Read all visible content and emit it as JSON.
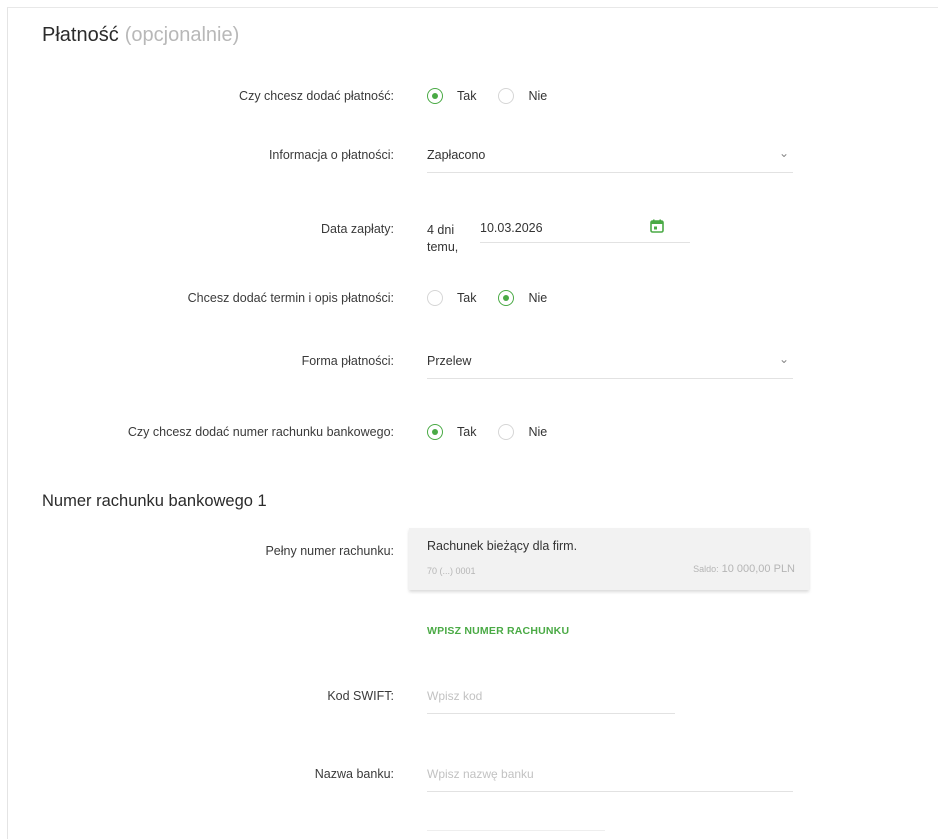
{
  "section": {
    "title": "Płatność",
    "optional": "(opcjonalnie)"
  },
  "add_payment": {
    "label": "Czy chcesz dodać płatność:",
    "yes": "Tak",
    "no": "Nie",
    "selected": "Tak"
  },
  "payment_info": {
    "label": "Informacja o płatności:",
    "value": "Zapłacono",
    "icon": "chevron-down-icon"
  },
  "payment_date": {
    "label": "Data zapłaty:",
    "relative": "4 dni temu,",
    "value": "10.03.2026",
    "icon": "calendar-icon"
  },
  "add_term": {
    "label": "Chcesz dodać termin i opis płatności:",
    "yes": "Tak",
    "no": "Nie",
    "selected": "Nie"
  },
  "payment_form": {
    "label": "Forma płatności:",
    "value": "Przelew",
    "icon": "chevron-down-icon"
  },
  "add_account": {
    "label": "Czy chcesz dodać numer rachunku bankowego:",
    "yes": "Tak",
    "no": "Nie",
    "selected": "Tak"
  },
  "bank_account": {
    "subtitle": "Numer rachunku bankowego 1",
    "full_number_label": "Pełny numer rachunku:",
    "account_name": "Rachunek bieżący dla firm.",
    "account_number": "70 (...) 0001",
    "saldo_label": "Saldo:",
    "saldo_value": "10 000,00 PLN",
    "enter_link": "WPISZ NUMER RACHUNKU"
  },
  "swift": {
    "label": "Kod SWIFT:",
    "placeholder": "Wpisz kod"
  },
  "bank_name": {
    "label": "Nazwa banku:",
    "placeholder": "Wpisz nazwę banku"
  },
  "colors": {
    "accent": "#4aaa45",
    "muted": "#b8b8b8"
  }
}
